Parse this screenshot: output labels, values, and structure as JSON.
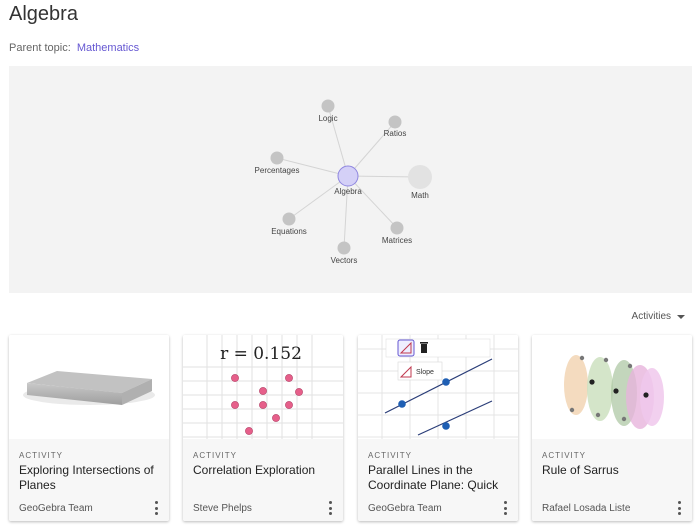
{
  "page": {
    "title": "Algebra",
    "parent_label": "Parent topic:",
    "parent_link": "Mathematics"
  },
  "graph": {
    "center": {
      "label": "Algebra"
    },
    "nodes": [
      {
        "label": "Logic"
      },
      {
        "label": "Ratios"
      },
      {
        "label": "Math"
      },
      {
        "label": "Matrices"
      },
      {
        "label": "Vectors"
      },
      {
        "label": "Equations"
      },
      {
        "label": "Percentages"
      }
    ]
  },
  "filter": {
    "label": "Activities"
  },
  "cards": [
    {
      "kind": "ACTIVITY",
      "title": "Exploring Intersections of Planes",
      "author": "GeoGebra Team"
    },
    {
      "kind": "ACTIVITY",
      "title": "Correlation Exploration",
      "author": "Steve Phelps",
      "thumb_formula": "r = 0.152"
    },
    {
      "kind": "ACTIVITY",
      "title": "Parallel Lines in the Coordinate Plane: Quick",
      "author": "GeoGebra Team",
      "thumb_tool_label": "Slope"
    },
    {
      "kind": "ACTIVITY",
      "title": "Rule of Sarrus",
      "author": "Rafael Losada Liste"
    }
  ],
  "colors": {
    "accent": "#6557d2",
    "center_node": "#d4d0f7",
    "node": "#c4c4c4",
    "panel_bg": "#f3f3f3",
    "dot_pink": "#e65f8a",
    "dot_blue": "#1f5fb4"
  },
  "icons": [
    "chevron-down-icon",
    "more-vert-icon",
    "slope-tool-icon",
    "trash-icon"
  ]
}
